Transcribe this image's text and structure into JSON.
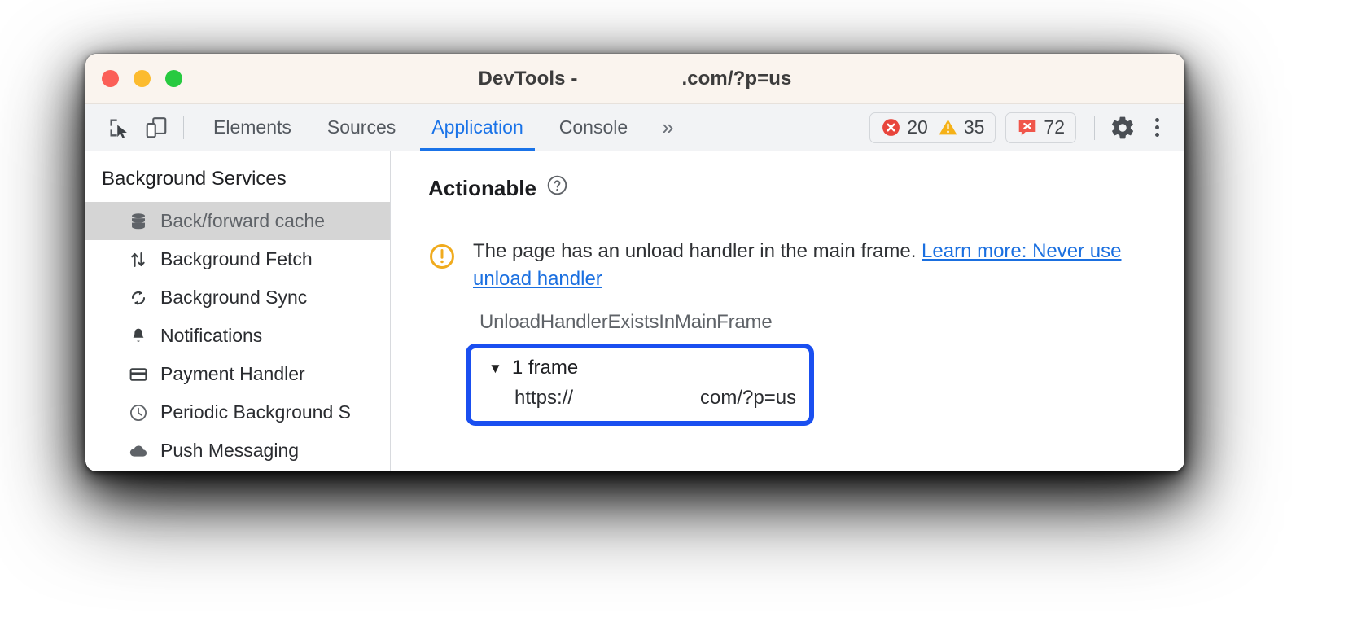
{
  "window": {
    "title_prefix": "DevTools -",
    "title_suffix": ".com/?p=us",
    "traffic_lights": {
      "close": "close",
      "minimize": "minimize",
      "maximize": "maximize"
    }
  },
  "toolbar": {
    "inspect_icon": "inspect-element-icon",
    "device_icon": "device-toolbar-icon",
    "tabs": [
      {
        "label": "Elements",
        "active": false
      },
      {
        "label": "Sources",
        "active": false
      },
      {
        "label": "Application",
        "active": true
      },
      {
        "label": "Console",
        "active": false
      }
    ],
    "more_tabs_label": "»",
    "counters": {
      "errors": "20",
      "warnings": "35",
      "issues": "72"
    },
    "settings_icon": "gear-icon",
    "menu_icon": "kebab-menu-icon"
  },
  "sidebar": {
    "header": "Background Services",
    "items": [
      {
        "label": "Back/forward cache",
        "icon": "database-icon",
        "selected": true
      },
      {
        "label": "Background Fetch",
        "icon": "arrows-up-down-icon",
        "selected": false
      },
      {
        "label": "Background Sync",
        "icon": "sync-icon",
        "selected": false
      },
      {
        "label": "Notifications",
        "icon": "bell-icon",
        "selected": false
      },
      {
        "label": "Payment Handler",
        "icon": "credit-card-icon",
        "selected": false
      },
      {
        "label": "Periodic Background S",
        "icon": "clock-icon",
        "selected": false
      },
      {
        "label": "Push Messaging",
        "icon": "cloud-icon",
        "selected": false
      }
    ]
  },
  "main": {
    "section_title": "Actionable",
    "help_icon": "help-circle-icon",
    "issue": {
      "warning_icon": "warning-circle-icon",
      "message": "The page has an unload handler in the main frame.",
      "link_label": "Learn more: Never use unload handler"
    },
    "reason_code": "UnloadHandlerExistsInMainFrame",
    "frame_group": {
      "caret": "▼",
      "label": "1 frame",
      "url_prefix": "https://",
      "url_suffix": "com/?p=us"
    }
  },
  "colors": {
    "accent": "#1a73e8",
    "highlight_border": "#1a4ff0",
    "error_red": "#e8453c",
    "warning_amber": "#f5b117",
    "link_blue": "#1a6fe0"
  }
}
